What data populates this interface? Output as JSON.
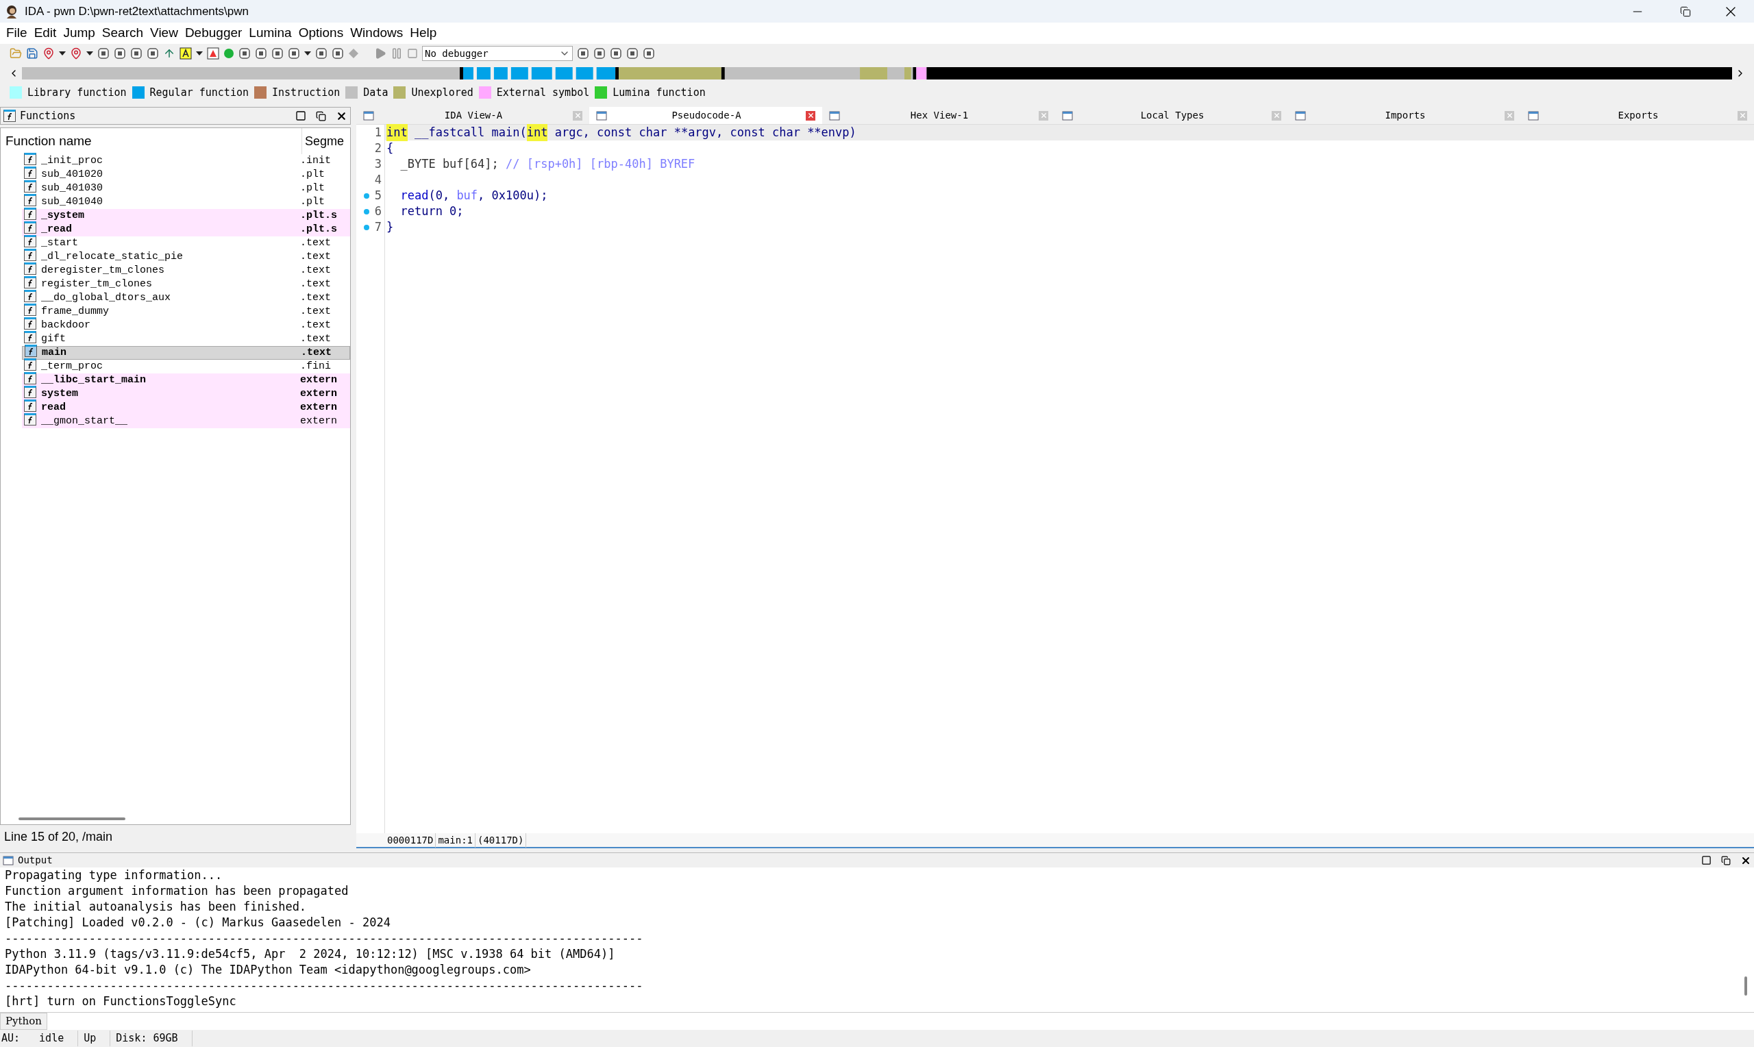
{
  "window": {
    "title": "IDA - pwn D:\\pwn-ret2text\\attachments\\pwn"
  },
  "menu": [
    "File",
    "Edit",
    "Jump",
    "Search",
    "View",
    "Debugger",
    "Lumina",
    "Options",
    "Windows",
    "Help"
  ],
  "toolbar": {
    "debugger_select": "No debugger"
  },
  "legend": [
    {
      "label": "Library function",
      "color": "#a8ffff"
    },
    {
      "label": "Regular function",
      "color": "#00a2e8"
    },
    {
      "label": "Instruction",
      "color": "#b97a57"
    },
    {
      "label": "Data",
      "color": "#c0c0c0"
    },
    {
      "label": "Unexplored",
      "color": "#b5b56a"
    },
    {
      "label": "External symbol",
      "color": "#ffa8ff"
    },
    {
      "label": "Lumina function",
      "color": "#33cc33"
    }
  ],
  "functions": {
    "title": "Functions",
    "columns": [
      "Function name",
      "Segme"
    ],
    "rows": [
      {
        "name": "_init_proc",
        "segment": ".init",
        "external": false,
        "bold": false,
        "selected": false
      },
      {
        "name": "sub_401020",
        "segment": ".plt",
        "external": false,
        "bold": false,
        "selected": false
      },
      {
        "name": "sub_401030",
        "segment": ".plt",
        "external": false,
        "bold": false,
        "selected": false
      },
      {
        "name": "sub_401040",
        "segment": ".plt",
        "external": false,
        "bold": false,
        "selected": false
      },
      {
        "name": "_system",
        "segment": ".plt.s",
        "external": true,
        "bold": true,
        "selected": false
      },
      {
        "name": "_read",
        "segment": ".plt.s",
        "external": true,
        "bold": true,
        "selected": false
      },
      {
        "name": "_start",
        "segment": ".text",
        "external": false,
        "bold": false,
        "selected": false
      },
      {
        "name": "_dl_relocate_static_pie",
        "segment": ".text",
        "external": false,
        "bold": false,
        "selected": false
      },
      {
        "name": "deregister_tm_clones",
        "segment": ".text",
        "external": false,
        "bold": false,
        "selected": false
      },
      {
        "name": "register_tm_clones",
        "segment": ".text",
        "external": false,
        "bold": false,
        "selected": false
      },
      {
        "name": "__do_global_dtors_aux",
        "segment": ".text",
        "external": false,
        "bold": false,
        "selected": false
      },
      {
        "name": "frame_dummy",
        "segment": ".text",
        "external": false,
        "bold": false,
        "selected": false
      },
      {
        "name": "backdoor",
        "segment": ".text",
        "external": false,
        "bold": false,
        "selected": false
      },
      {
        "name": "gift",
        "segment": ".text",
        "external": false,
        "bold": false,
        "selected": false
      },
      {
        "name": "main",
        "segment": ".text",
        "external": false,
        "bold": true,
        "selected": true
      },
      {
        "name": "_term_proc",
        "segment": ".fini",
        "external": false,
        "bold": false,
        "selected": false
      },
      {
        "name": "__libc_start_main",
        "segment": "extern",
        "external": true,
        "bold": true,
        "selected": false
      },
      {
        "name": "system",
        "segment": "extern",
        "external": true,
        "bold": true,
        "selected": false
      },
      {
        "name": "read",
        "segment": "extern",
        "external": true,
        "bold": true,
        "selected": false
      },
      {
        "name": "__gmon_start__",
        "segment": "extern",
        "external": true,
        "bold": false,
        "selected": false
      }
    ],
    "status": "Line 15 of 20, /main"
  },
  "tabs": [
    {
      "label": "IDA View-A",
      "selected": false
    },
    {
      "label": "Pseudocode-A",
      "selected": true
    },
    {
      "label": "Hex View-1",
      "selected": false
    },
    {
      "label": "Local Types",
      "selected": false
    },
    {
      "label": "Imports",
      "selected": false
    },
    {
      "label": "Exports",
      "selected": false
    }
  ],
  "code": {
    "lines": [
      {
        "number": "1",
        "marked": false,
        "current": true,
        "tokens": [
          {
            "kind": "highlight",
            "text": "int"
          },
          {
            "kind": "plain",
            "text": " __fastcall main("
          },
          {
            "kind": "highlight",
            "text": "int"
          },
          {
            "kind": "plain",
            "text": " argc, const char **argv, const char **envp)"
          }
        ]
      },
      {
        "number": "2",
        "marked": false,
        "current": false,
        "tokens": [
          {
            "kind": "plain",
            "text": "{"
          }
        ]
      },
      {
        "number": "3",
        "marked": false,
        "current": false,
        "tokens": [
          {
            "kind": "dim",
            "text": "  _BYTE buf[64]; "
          },
          {
            "kind": "comment",
            "text": "// [rsp+0h] [rbp-40h] BYREF"
          }
        ]
      },
      {
        "number": "4",
        "marked": false,
        "current": false
      },
      {
        "number": "5",
        "marked": true,
        "current": false,
        "tokens": [
          {
            "kind": "func",
            "text": "  read"
          },
          {
            "kind": "plain",
            "text": "(0, "
          },
          {
            "kind": "var",
            "text": "buf"
          },
          {
            "kind": "plain",
            "text": ", 0x100u);"
          }
        ]
      },
      {
        "number": "6",
        "marked": true,
        "current": false,
        "tokens": [
          {
            "kind": "plain",
            "text": "  return 0;"
          }
        ]
      },
      {
        "number": "7",
        "marked": true,
        "current": false,
        "tokens": [
          {
            "kind": "plain",
            "text": "}"
          }
        ]
      }
    ],
    "status": [
      "0000117D",
      "main:1",
      "(40117D)"
    ]
  },
  "output": {
    "title": "Output",
    "lines": [
      "Propagating type information...",
      "Function argument information has been propagated",
      "The initial autoanalysis has been finished.",
      "[Patching] Loaded v0.2.0 - (c) Markus Gaasedelen - 2024",
      "-------------------------------------------------------------------------------------------",
      "Python 3.11.9 (tags/v3.11.9:de54cf5, Apr  2 2024, 10:12:12) [MSC v.1938 64 bit (AMD64)]",
      "IDAPython 64-bit v9.1.0 (c) The IDAPython Team <idapython@googlegroups.com>",
      "-------------------------------------------------------------------------------------------",
      "[hrt] turn on FunctionsToggleSync"
    ],
    "language": "Python"
  },
  "status_bar": [
    "AU:",
    "idle",
    "Up",
    "Disk: 69GB"
  ]
}
